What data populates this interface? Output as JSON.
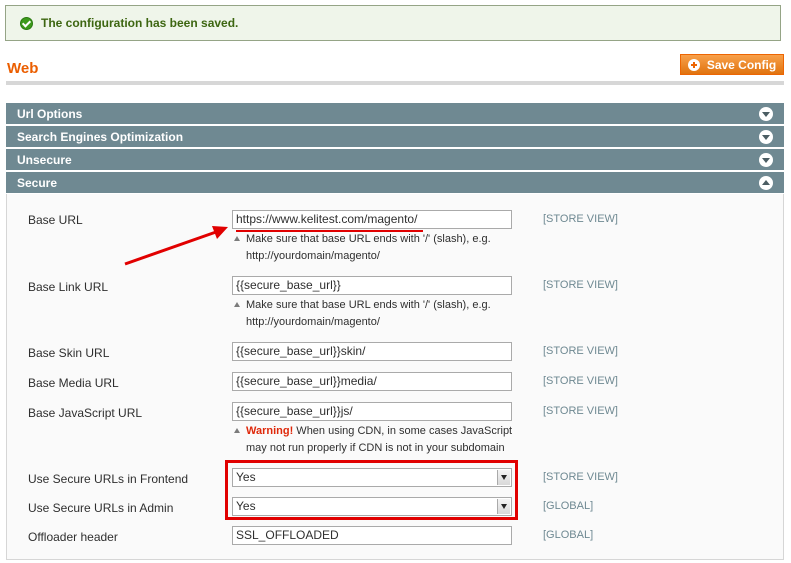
{
  "message": {
    "text": "The configuration has been saved."
  },
  "page": {
    "title": "Web",
    "save_label": "Save Config"
  },
  "sections": [
    {
      "label": "Url Options",
      "state": "collapsed"
    },
    {
      "label": "Search Engines Optimization",
      "state": "collapsed"
    },
    {
      "label": "Unsecure",
      "state": "collapsed"
    },
    {
      "label": "Secure",
      "state": "expanded"
    }
  ],
  "secure": {
    "base_url": {
      "label": "Base URL",
      "value": "https://www.kelitest.com/magento/",
      "scope": "[STORE VIEW]",
      "note_line1": "Make sure that base URL ends with '/' (slash), e.g.",
      "note_line2": "http://yourdomain/magento/"
    },
    "base_link_url": {
      "label": "Base Link URL",
      "value": "{{secure_base_url}}",
      "scope": "[STORE VIEW]",
      "note_line1": "Make sure that base URL ends with '/' (slash), e.g.",
      "note_line2": "http://yourdomain/magento/"
    },
    "base_skin_url": {
      "label": "Base Skin URL",
      "value": "{{secure_base_url}}skin/",
      "scope": "[STORE VIEW]"
    },
    "base_media_url": {
      "label": "Base Media URL",
      "value": "{{secure_base_url}}media/",
      "scope": "[STORE VIEW]"
    },
    "base_js_url": {
      "label": "Base JavaScript URL",
      "value": "{{secure_base_url}}js/",
      "scope": "[STORE VIEW]",
      "warning_label": "Warning!",
      "warning_rest": " When using CDN, in some cases JavaScript",
      "warning_line2": "may not run properly if CDN is not in your subdomain"
    },
    "use_secure_frontend": {
      "label": "Use Secure URLs in Frontend",
      "value": "Yes",
      "scope": "[STORE VIEW]"
    },
    "use_secure_admin": {
      "label": "Use Secure URLs in Admin",
      "value": "Yes",
      "scope": "[GLOBAL]"
    },
    "offloader_header": {
      "label": "Offloader header",
      "value": "SSL_OFFLOADED",
      "scope": "[GLOBAL]"
    }
  },
  "colors": {
    "accent": "#eb5e00",
    "section_bar": "#6f8992",
    "annotation": "#e10000",
    "success": "#3d6611"
  },
  "icons": [
    "checkmark-icon",
    "save-plus-icon",
    "chevron-down-icon",
    "chevron-up-icon",
    "note-triangle-icon",
    "dropdown-arrow-icon"
  ]
}
